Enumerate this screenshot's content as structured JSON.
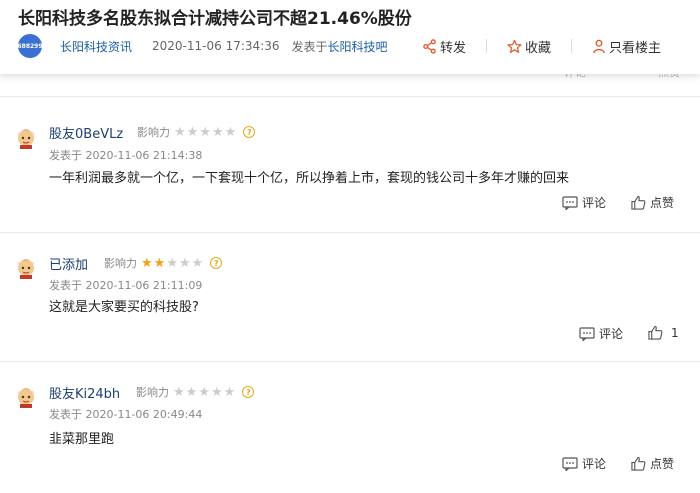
{
  "header": {
    "title": "长阳科技多名股东拟合计减持公司不超21.46%股份",
    "logo_text": "688299",
    "source": "长阳科技资讯",
    "time": "2020-11-06 17:34:36",
    "posted_prefix": "发表于",
    "forum": "长阳科技吧",
    "share_label": "转发",
    "collect_label": "收藏",
    "author_only_label": "只看楼主"
  },
  "peek": {
    "comment_label": "评论",
    "like_label": "点赞"
  },
  "comments": [
    {
      "username": "股友0BeVLz",
      "influence_label": "影响力",
      "stars": 0,
      "time": "发表于 2020-11-06 21:14:38",
      "text": "一年利润最多就一个亿，一下套现十个亿，所以挣着上市，套现的钱公司十多年才赚的回来",
      "comment_label": "评论",
      "like_label": "点赞"
    },
    {
      "username": "已添加",
      "influence_label": "影响力",
      "stars": 2,
      "time": "发表于 2020-11-06 21:11:09",
      "text": "这就是大家要买的科技股?",
      "comment_label": "评论",
      "like_label": "1"
    },
    {
      "username": "股友Ki24bh",
      "influence_label": "影响力",
      "stars": 0,
      "time": "发表于 2020-11-06 20:49:44",
      "text": "韭菜那里跑",
      "comment_label": "评论",
      "like_label": "点赞"
    }
  ],
  "colors": {
    "username": "#1d3f73",
    "star_on": "#f2a20c",
    "star_off": "#cccccc",
    "link": "#1b5fa8"
  },
  "icons": [
    "share-icon",
    "star-icon",
    "person-icon",
    "comment-icon",
    "thumbs-up-icon",
    "help-icon",
    "avatar-icon"
  ]
}
